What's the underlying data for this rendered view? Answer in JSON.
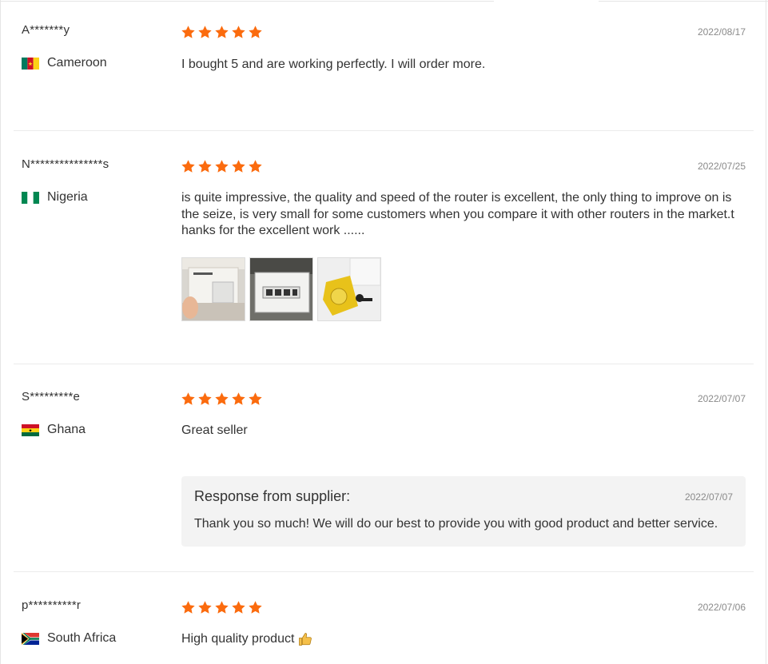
{
  "colors": {
    "star": "#fb6b0e",
    "divider": "#ebebeb",
    "date": "#8a8a8a",
    "response_bg": "#f3f3f3"
  },
  "reviews": [
    {
      "user": "A*******y",
      "country": "Cameroon",
      "flag_icon": "cameroon-flag-icon",
      "rating": 5,
      "date": "2022/08/17",
      "text": "I bought 5 and are working perfectly. I will order more."
    },
    {
      "user": "N***************s",
      "country": "Nigeria",
      "flag_icon": "nigeria-flag-icon",
      "rating": 5,
      "date": "2022/07/25",
      "text": "is quite impressive, the quality and speed of the router is excellent, the only thing to improve on is the seize, is very small for some customers when you compare it with other routers in the market.t hanks for the excellent work ......",
      "photos": [
        "router-box-photo",
        "router-ports-photo",
        "router-package-photo"
      ]
    },
    {
      "user": "S*********e",
      "country": "Ghana",
      "flag_icon": "ghana-flag-icon",
      "rating": 5,
      "date": "2022/07/07",
      "text": "Great seller",
      "response": {
        "title": "Response from supplier:",
        "date": "2022/07/07",
        "text": "Thank you so much! We will do our best to provide you with good product and better service."
      }
    },
    {
      "user": "p**********r",
      "country": "South Africa",
      "flag_icon": "south-africa-flag-icon",
      "rating": 5,
      "date": "2022/07/06",
      "text": "High quality product",
      "emoji_icon": "thumbs-up-icon"
    }
  ]
}
